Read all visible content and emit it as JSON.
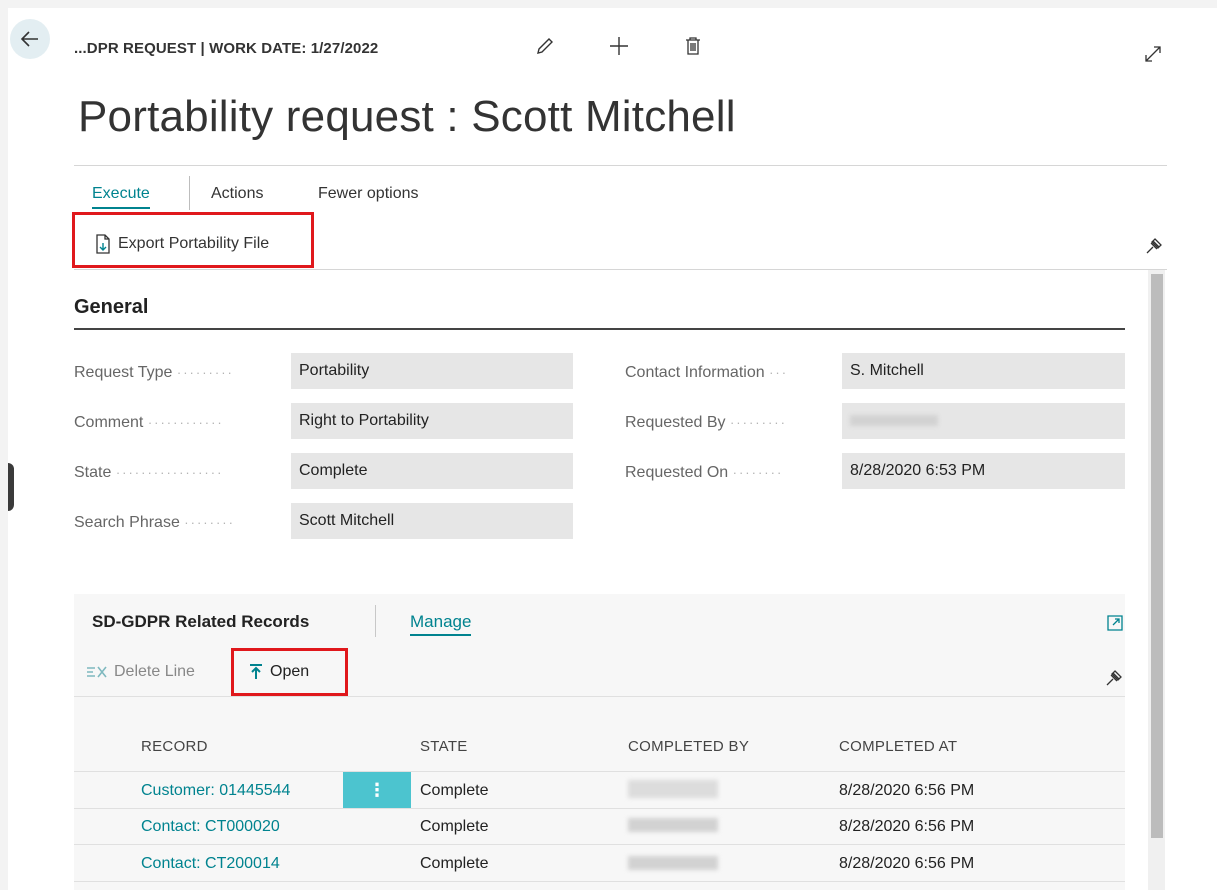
{
  "header": {
    "breadcrumb": "...DPR REQUEST | WORK DATE: 1/27/2022",
    "title": "Portability request : Scott Mitchell"
  },
  "icons": {
    "back": "arrow-left-icon",
    "edit": "pencil-icon",
    "new": "plus-icon",
    "delete": "trash-icon",
    "expand": "expand-diagonal-icon",
    "pin": "pin-icon",
    "export": "document-export-icon",
    "delete_line": "delete-row-icon",
    "open": "open-upload-icon",
    "panel_expand": "panel-expand-icon"
  },
  "tabs": {
    "execute": "Execute",
    "actions": "Actions",
    "fewer_options": "Fewer options"
  },
  "actions": {
    "export_portability": "Export Portability File"
  },
  "general": {
    "heading": "General",
    "left_fields": [
      {
        "label": "Request Type",
        "value": "Portability"
      },
      {
        "label": "Comment",
        "value": "Right to Portability"
      },
      {
        "label": "State",
        "value": "Complete"
      },
      {
        "label": "Search Phrase",
        "value": "Scott Mitchell"
      }
    ],
    "right_fields": [
      {
        "label": "Contact Information",
        "value": "S. Mitchell"
      },
      {
        "label": "Requested By",
        "value": ""
      },
      {
        "label": "Requested On",
        "value": "8/28/2020 6:53 PM"
      }
    ]
  },
  "related": {
    "title": "SD-GDPR Related Records",
    "manage": "Manage",
    "delete_line": "Delete Line",
    "open": "Open",
    "columns": [
      "RECORD",
      "STATE",
      "COMPLETED BY",
      "COMPLETED AT"
    ],
    "row_menu_glyph": "⋮",
    "rows": [
      {
        "record": "Customer: 01445544",
        "state": "Complete",
        "completed_by": "",
        "completed_at": "8/28/2020 6:56 PM"
      },
      {
        "record": "Contact: CT000020",
        "state": "Complete",
        "completed_by": "",
        "completed_at": "8/28/2020 6:56 PM"
      },
      {
        "record": "Contact: CT200014",
        "state": "Complete",
        "completed_by": "",
        "completed_at": "8/28/2020 6:56 PM"
      }
    ]
  },
  "colors": {
    "accent": "#00838f",
    "highlight_box": "#e0181c",
    "row_menu": "#4cc4cf"
  }
}
